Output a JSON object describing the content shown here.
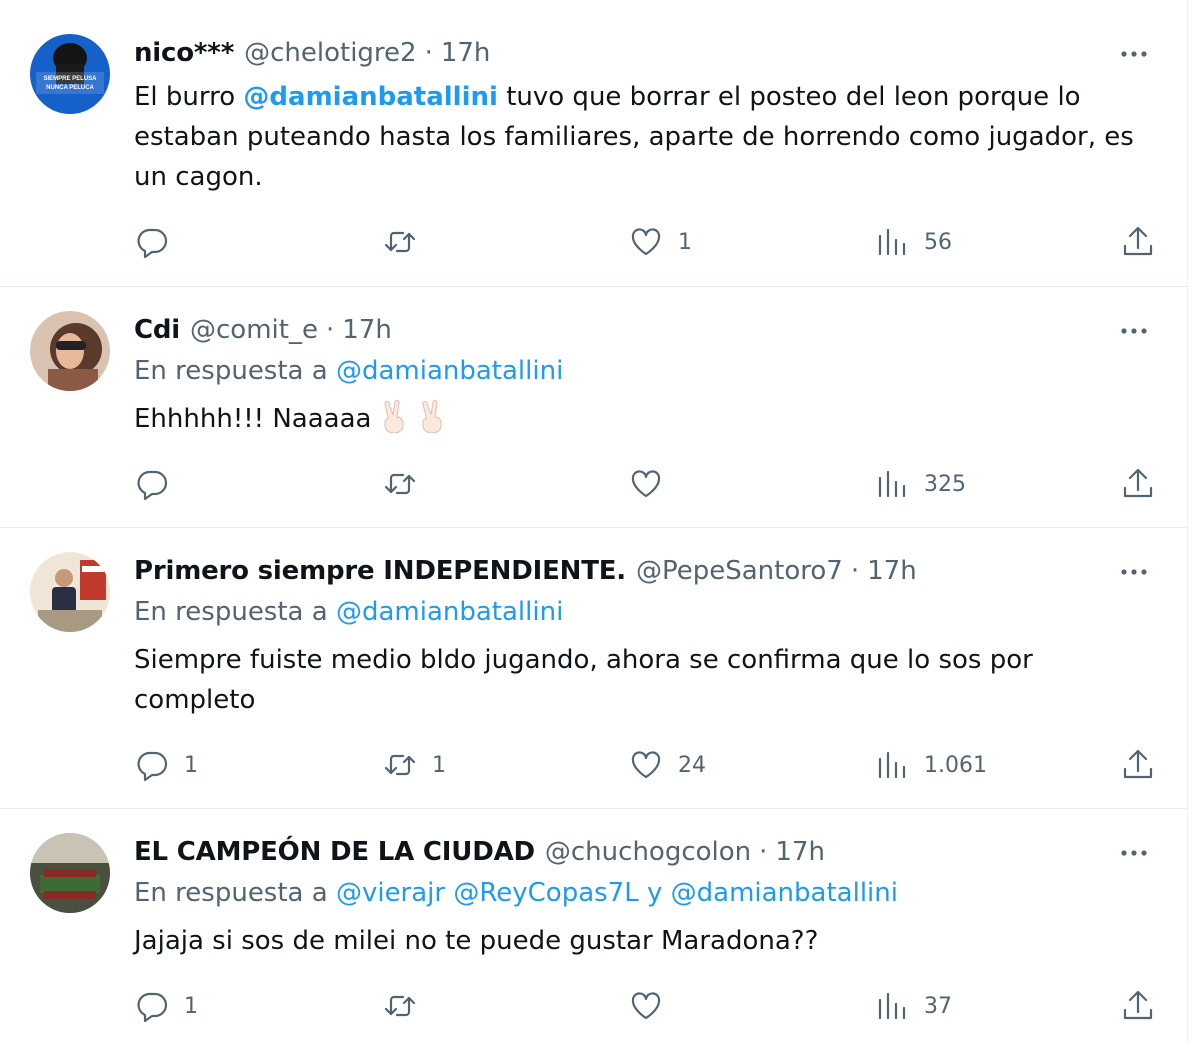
{
  "tweets": [
    {
      "name": "nico***",
      "handle": "@chelotigre2",
      "time": "17h",
      "text_pre": "El burro ",
      "text_mention": "@damianbatallini",
      "text_post": " tuvo que borrar el posteo del leon porque lo estaban puteando hasta los familiares, aparte de horrendo como jugador, es un cagon.",
      "avatar_text_1": "SIEMPRE PELUSA",
      "avatar_text_2": "NUNCA PELUCA",
      "replies": "",
      "retweets": "",
      "likes": "1",
      "views": "56"
    },
    {
      "name": "Cdi",
      "handle": "@comit_e",
      "time": "17h",
      "reply_prefix": "En respuesta a ",
      "reply_mentions": "@damianbatallini",
      "text": "Ehhhhh!!! Naaaaa",
      "emojis": [
        "victory-hand-emoji",
        "victory-hand-emoji"
      ],
      "replies": "",
      "retweets": "",
      "likes": "",
      "views": "325"
    },
    {
      "name": "Primero siempre INDEPENDIENTE.",
      "handle": "@PepeSantoro7",
      "time": "17h",
      "reply_prefix": "En respuesta a ",
      "reply_mentions": "@damianbatallini",
      "text": "Siempre fuiste medio bldo jugando, ahora se confirma que lo sos por completo",
      "replies": "1",
      "retweets": "1",
      "likes": "24",
      "views": "1.061"
    },
    {
      "name": "EL CAMPEÓN DE LA CIUDAD",
      "handle": "@chuchogcolon",
      "time": "17h",
      "reply_prefix": "En respuesta a ",
      "reply_mentions": "@vierajr @ReyCopas7L y @damianbatallini",
      "text": "Jajaja si sos de milei no te puede gustar Maradona??",
      "replies": "1",
      "retweets": "",
      "likes": "",
      "views": "37"
    }
  ],
  "colors": {
    "text_primary": "#0f1419",
    "text_secondary": "#536471",
    "link": "#1d9bf0",
    "divider": "#e7ecef"
  }
}
